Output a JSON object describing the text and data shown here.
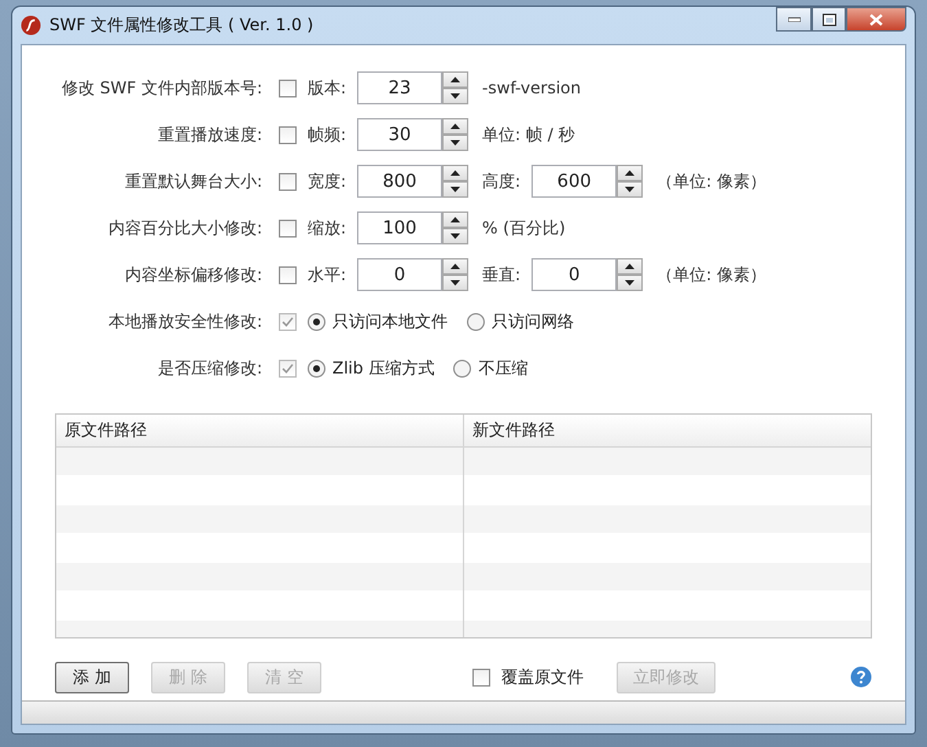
{
  "window": {
    "title": "SWF 文件属性修改工具 ( Ver. 1.0 )"
  },
  "options": [
    {
      "kind": "spin",
      "label": "修改 SWF 文件内部版本号:",
      "checked": false,
      "disabled": false,
      "fields": [
        {
          "label": "版本:",
          "value": "23"
        }
      ],
      "unit": "-swf-version"
    },
    {
      "kind": "spin",
      "label": "重置播放速度:",
      "checked": false,
      "disabled": false,
      "fields": [
        {
          "label": "帧频:",
          "value": "30"
        }
      ],
      "unit": "单位: 帧 / 秒"
    },
    {
      "kind": "spin",
      "label": "重置默认舞台大小:",
      "checked": false,
      "disabled": false,
      "fields": [
        {
          "label": "宽度:",
          "value": "800"
        },
        {
          "label": "高度:",
          "value": "600"
        }
      ],
      "unit": "（单位: 像素）"
    },
    {
      "kind": "spin",
      "label": "内容百分比大小修改:",
      "checked": false,
      "disabled": false,
      "fields": [
        {
          "label": "缩放:",
          "value": "100"
        }
      ],
      "unit": "% (百分比)"
    },
    {
      "kind": "spin",
      "label": "内容坐标偏移修改:",
      "checked": false,
      "disabled": false,
      "fields": [
        {
          "label": "水平:",
          "value": "0"
        },
        {
          "label": "垂直:",
          "value": "0"
        }
      ],
      "unit": "（单位: 像素）"
    },
    {
      "kind": "radio",
      "label": "本地播放安全性修改:",
      "checked": true,
      "disabled": true,
      "choices": [
        {
          "label": "只访问本地文件",
          "selected": true
        },
        {
          "label": "只访问网络",
          "selected": false
        }
      ]
    },
    {
      "kind": "radio",
      "label": "是否压缩修改:",
      "checked": true,
      "disabled": true,
      "choices": [
        {
          "label": "Zlib 压缩方式",
          "selected": true
        },
        {
          "label": "不压缩",
          "selected": false
        }
      ]
    }
  ],
  "table": {
    "columns": [
      "原文件路径",
      "新文件路径"
    ]
  },
  "buttons": [
    {
      "label": "添 加",
      "disabled": false
    },
    {
      "label": "删 除",
      "disabled": true
    },
    {
      "label": "清 空",
      "disabled": true
    }
  ],
  "overwrite": {
    "label": "覆盖原文件",
    "checked": false
  },
  "apply": {
    "label": "立即修改",
    "disabled": true
  }
}
